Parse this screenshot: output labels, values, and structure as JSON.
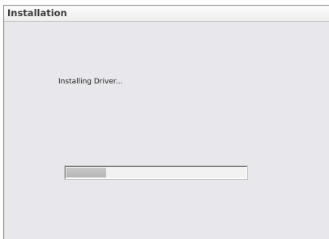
{
  "window": {
    "title": "Installation"
  },
  "main": {
    "status_text": "Installing Driver..."
  },
  "progress": {
    "value_fraction": 0.22
  },
  "colors": {
    "title_bar": "#f5f5f5",
    "content_background": "#e8e8ec",
    "progress_fill": "#bdbdbd"
  }
}
